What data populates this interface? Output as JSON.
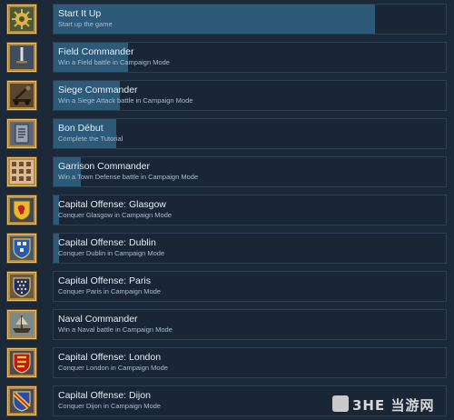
{
  "achievements": [
    {
      "title": "Start It Up",
      "description": "Start up the game",
      "progress": 0.82,
      "icon": "gear-icon"
    },
    {
      "title": "Field Commander",
      "description": "Win a Field battle in Campaign Mode",
      "progress": 0.19,
      "icon": "sword-icon"
    },
    {
      "title": "Siege Commander",
      "description": "Win a Siege Attack battle in Campaign Mode",
      "progress": 0.17,
      "icon": "catapult-icon"
    },
    {
      "title": "Bon Début",
      "description": "Complete the Tutorial",
      "progress": 0.16,
      "icon": "book-icon"
    },
    {
      "title": "Garrison Commander",
      "description": "Win a Town Defense battle in Campaign Mode",
      "progress": 0.07,
      "icon": "map-grid-icon"
    },
    {
      "title": "Capital Offense: Glasgow",
      "description": "Conquer Glasgow in Campaign Mode",
      "progress": 0.015,
      "icon": "lion-shield-icon"
    },
    {
      "title": "Capital Offense: Dublin",
      "description": "Conquer Dublin in Campaign Mode",
      "progress": 0.015,
      "icon": "castles-shield-icon"
    },
    {
      "title": "Capital Offense: Paris",
      "description": "Conquer Paris in Campaign Mode",
      "progress": 0,
      "icon": "fleur-shield-icon"
    },
    {
      "title": "Naval Commander",
      "description": "Win a Naval battle in Campaign Mode",
      "progress": 0,
      "icon": "ship-icon"
    },
    {
      "title": "Capital Offense: London",
      "description": "Conquer London in Campaign Mode",
      "progress": 0,
      "icon": "lions-shield-icon"
    },
    {
      "title": "Capital Offense: Dijon",
      "description": "Conquer Dijon in Campaign Mode",
      "progress": 0,
      "icon": "bend-shield-icon"
    }
  ],
  "watermark": {
    "text": "3HE 当游网"
  },
  "colors": {
    "background": "#1b2838",
    "progress": "#2e5a7a",
    "frame": "#b88a3a"
  }
}
